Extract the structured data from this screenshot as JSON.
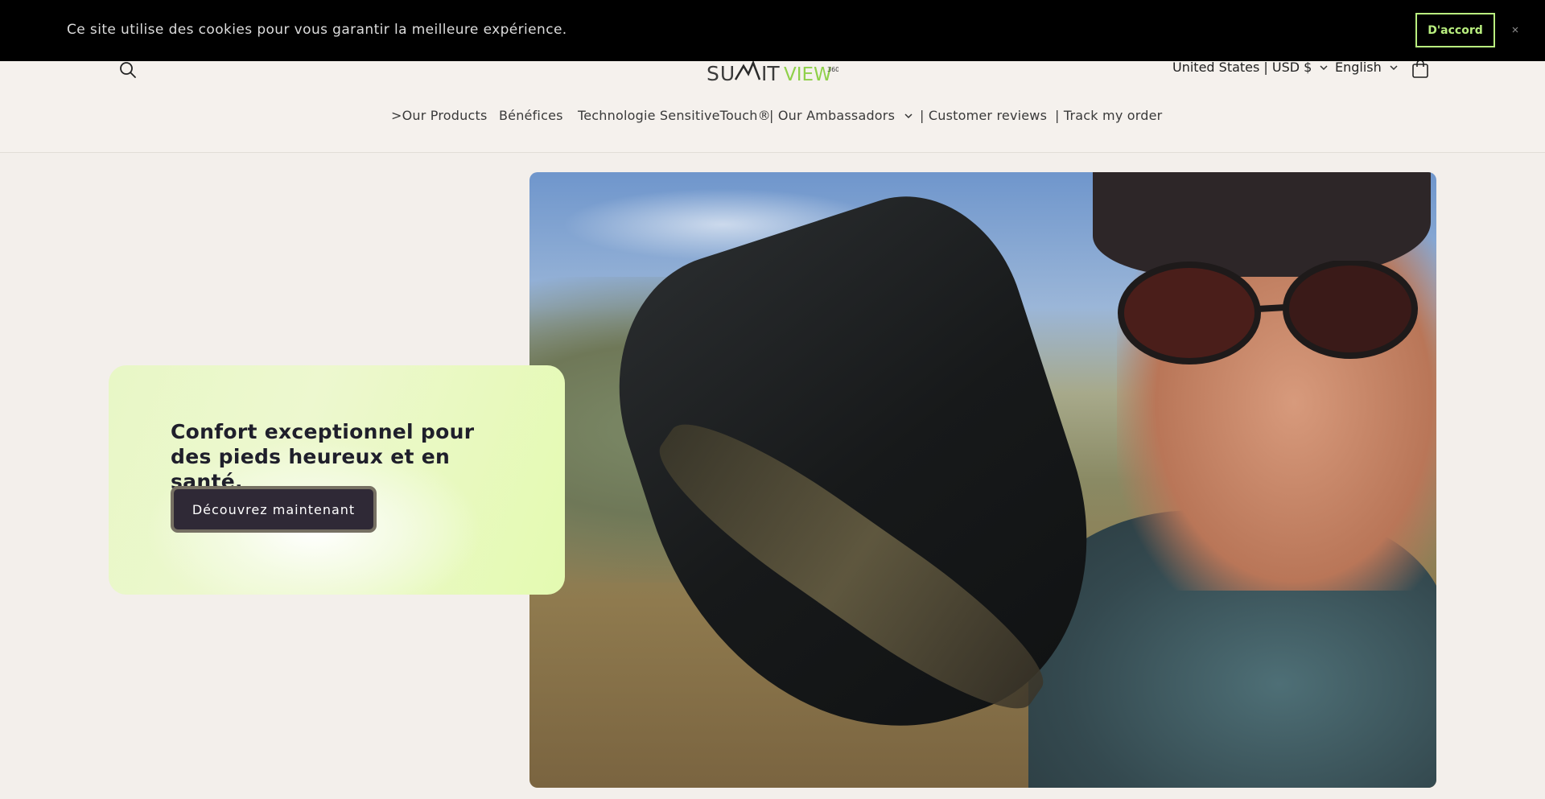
{
  "cookie_banner": {
    "message": "Ce site utilise des cookies pour vous garantir la meilleure expérience.",
    "accept_label": "D'accord",
    "close_icon": "close-icon"
  },
  "header": {
    "logo_text": "SUMMITVIEW",
    "logo_superscript": "360",
    "currency_label": "United States | USD $",
    "language_label": "English",
    "icons": [
      "search-icon",
      "chevron-down-icon",
      "cart-icon"
    ]
  },
  "nav": {
    "items": [
      {
        "label": ">Our Products"
      },
      {
        "label": "Bénéfices"
      },
      {
        "label": "Technologie SensitiveTouch®"
      },
      {
        "label": "| Our Ambassadors"
      },
      {
        "label": "| Customer reviews"
      },
      {
        "label": "| Track my order"
      }
    ]
  },
  "hero": {
    "heading": "Confort exceptionnel pour des pieds heureux et en santé.",
    "button_label": "Découvrez maintenant",
    "image_alt": "woman with sunglasses holding up a black hiking boot"
  },
  "colors": {
    "banner_bg": "#000000",
    "accept_border": "#b9ef7f",
    "page_bg": "#f3efeb",
    "button_bg": "#2f2936",
    "card_gradient_end": "#e4fab1"
  }
}
